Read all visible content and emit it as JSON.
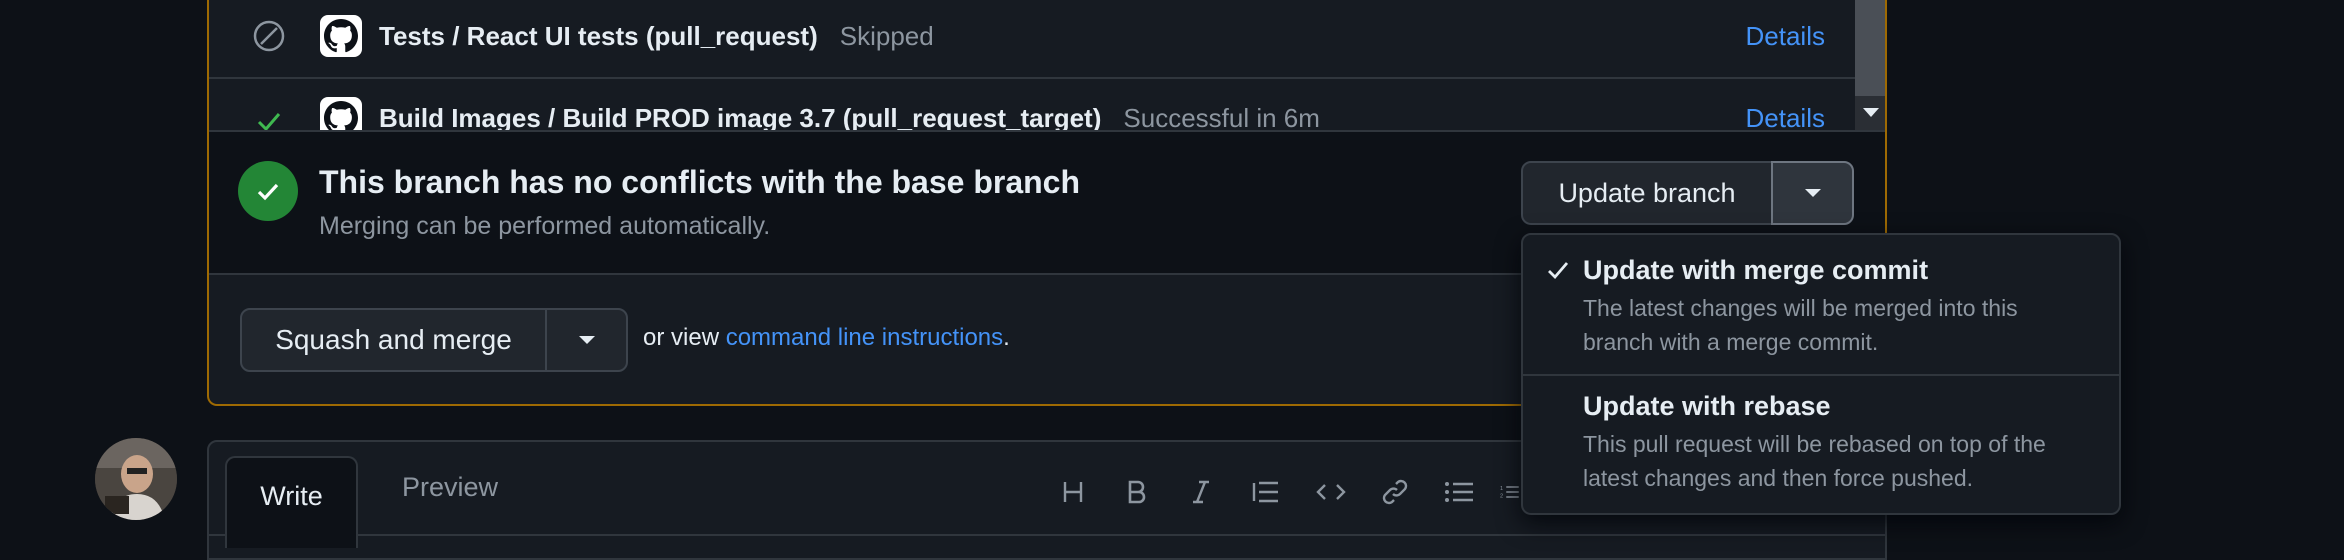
{
  "checks": [
    {
      "title": "Tests / React UI tests (pull_request)",
      "status": "Skipped",
      "status_kind": "skipped",
      "link": "Details"
    },
    {
      "title": "Build Images / Build PROD image 3.7 (pull_request_target)",
      "status": "Successful in 6m",
      "status_kind": "success",
      "link": "Details"
    }
  ],
  "merge_status": {
    "title": "This branch has no conflicts with the base branch",
    "subtitle": "Merging can be performed automatically."
  },
  "update_branch": {
    "label": "Update branch"
  },
  "update_menu": {
    "items": [
      {
        "title": "Update with merge commit",
        "description": "The latest changes will be merged into this branch with a merge commit.",
        "selected": true
      },
      {
        "title": "Update with rebase",
        "description": "This pull request will be rebased on top of the latest changes and then force pushed.",
        "selected": false
      }
    ]
  },
  "squash": {
    "label": "Squash and merge",
    "or_view_prefix": "or view ",
    "link_text": "command line instructions",
    "suffix": "."
  },
  "comment": {
    "tabs": [
      "Write",
      "Preview"
    ],
    "toolbar_icons": [
      "heading-icon",
      "bold-icon",
      "italic-icon",
      "quote-icon",
      "code-icon",
      "link-icon",
      "unordered-list-icon",
      "ordered-list-icon"
    ]
  },
  "colors": {
    "accent_link": "#4493f8",
    "success": "#238636",
    "attention_border": "#9e6a03",
    "background": "#0d1117"
  }
}
